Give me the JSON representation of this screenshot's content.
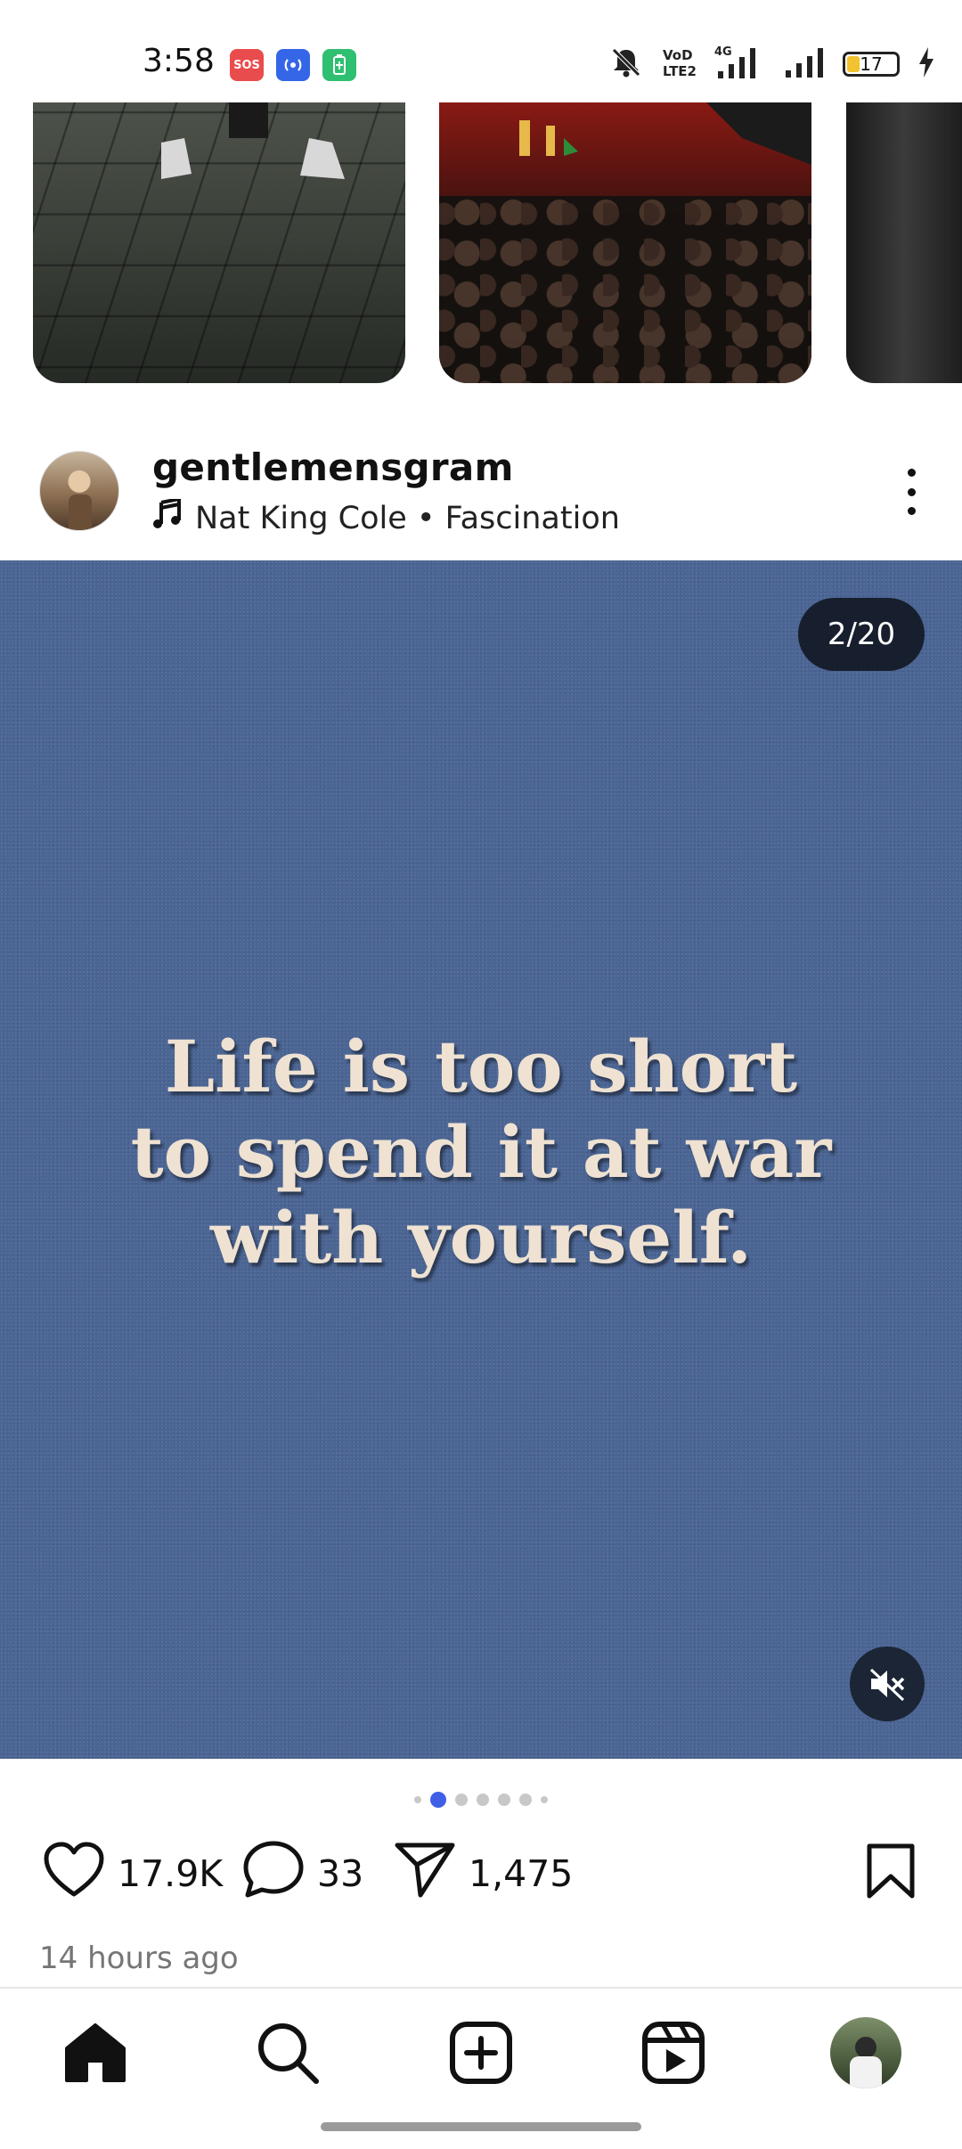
{
  "status_bar": {
    "time": "3:58",
    "chips": [
      {
        "name": "sos",
        "label": "SOS",
        "color": "#e94c4c"
      },
      {
        "name": "hotspot",
        "label": "((•))",
        "color": "#3566e8"
      },
      {
        "name": "battery-saver",
        "label": "▯",
        "color": "#2fbf71"
      }
    ],
    "network_label": "4G",
    "volte_label": "VoD LTE2",
    "battery_level": "17"
  },
  "post": {
    "username": "gentlemensgram",
    "music": "Nat King Cole • Fascination",
    "media_counter": "2/20",
    "quote_lines": [
      "Life is too short",
      "to spend it at war",
      "with yourself."
    ],
    "media_color": "#4b6594",
    "carousel": {
      "total_dots": 7,
      "active_index": 1
    },
    "likes": "17.9K",
    "comments": "33",
    "shares": "1,475",
    "timestamp": "14 hours ago"
  },
  "bottom_nav": {
    "items": [
      "home-icon",
      "search-icon",
      "create-icon",
      "reels-icon",
      "profile-avatar"
    ],
    "active": "home-icon"
  },
  "colors": {
    "accent": "#3f5fe6",
    "text": "#111111",
    "muted": "#767676"
  }
}
